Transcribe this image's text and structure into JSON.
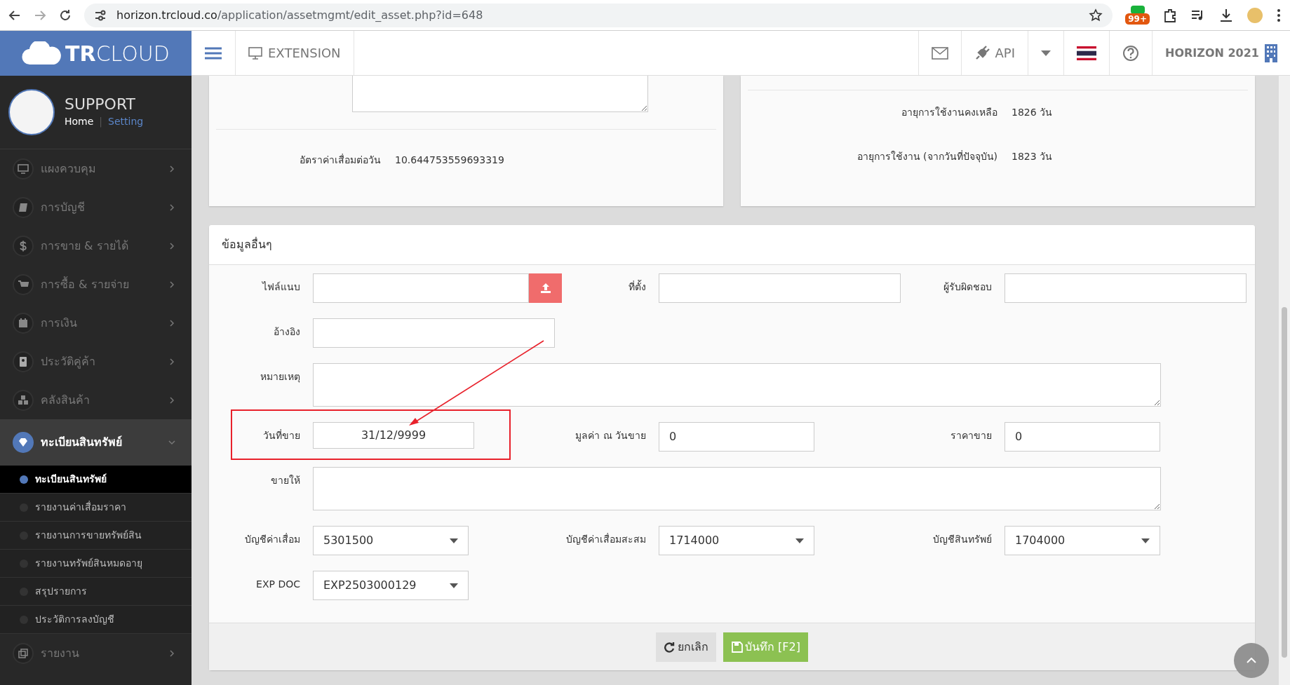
{
  "browser": {
    "url_host": "horizon.trcloud.co",
    "url_path": "/application/assetmgmt/edit_asset.php?id=648",
    "extension_badge": "99+"
  },
  "header": {
    "logo_bold": "TR",
    "logo_light": "CLOUD",
    "extension": "EXTENSION",
    "api": "API",
    "company": "HORIZON 2021"
  },
  "user": {
    "name": "SUPPORT",
    "home": "Home",
    "separator": "|",
    "setting": "Setting"
  },
  "sidebar": {
    "items": [
      {
        "label": "แผงควบคุม",
        "expanded": false,
        "selected": false
      },
      {
        "label": "การบัญชี",
        "expanded": false,
        "selected": false
      },
      {
        "label": "การขาย & รายได้",
        "expanded": false,
        "selected": false
      },
      {
        "label": "การซื้อ & รายจ่าย",
        "expanded": false,
        "selected": false
      },
      {
        "label": "การเงิน",
        "expanded": false,
        "selected": false
      },
      {
        "label": "ประวัติคู่ค้า",
        "expanded": false,
        "selected": false
      },
      {
        "label": "คลังสินค้า",
        "expanded": false,
        "selected": false
      },
      {
        "label": "ทะเบียนสินทรัพย์",
        "expanded": true,
        "selected": true,
        "children": [
          {
            "label": "ทะเบียนสินทรัพย์",
            "selected": true
          },
          {
            "label": "รายงานค่าเสื่อมราคา",
            "selected": false
          },
          {
            "label": "รายงานการขายทรัพย์สิน",
            "selected": false
          },
          {
            "label": "รายงานทรัพย์สินหมดอายุ",
            "selected": false
          },
          {
            "label": "สรุปรายการ",
            "selected": false
          },
          {
            "label": "ประวัติการลงบัญชี",
            "selected": false
          }
        ]
      },
      {
        "label": "รายงาน",
        "expanded": false,
        "selected": false
      }
    ]
  },
  "summary_left": {
    "rows": [
      {
        "label": "อัตราค่าเสื่อมต่อวัน",
        "value": "10.644753559693319"
      }
    ]
  },
  "summary_right": {
    "rows": [
      {
        "label": "อายุการใช้งานคงเหลือ",
        "value": "1826 วัน"
      },
      {
        "label": "อายุการใช้งาน (จากวันที่ปัจจุบัน)",
        "value": "1823 วัน"
      }
    ]
  },
  "panel": {
    "title": "ข้อมูลอื่นๆ",
    "rows": [
      [
        {
          "kind": "file",
          "label": "ไฟล์แนบ"
        },
        {
          "kind": "text",
          "label": "ที่ตั้ง"
        },
        {
          "kind": "text",
          "label": "ผู้รับผิดชอบ"
        }
      ],
      [
        {
          "kind": "text",
          "label": "อ้างอิง"
        }
      ],
      [
        {
          "kind": "textarea",
          "label": "หมายเหตุ"
        }
      ],
      [
        {
          "kind": "date",
          "label": "วันที่ขาย",
          "value": "31/12/9999"
        },
        {
          "kind": "short",
          "label": "มูลค่า ณ วันขาย",
          "value": "0"
        },
        {
          "kind": "short",
          "label": "ราคาขาย",
          "value": "0"
        }
      ],
      [
        {
          "kind": "textarea",
          "label": "ขายให้"
        }
      ],
      [
        {
          "kind": "select",
          "label": "บัญชีค่าเสื่อม",
          "value": "5301500"
        },
        {
          "kind": "select",
          "label": "บัญชีค่าเสื่อมสะสม",
          "value": "1714000"
        },
        {
          "kind": "select",
          "label": "บัญชีสินทรัพย์",
          "value": "1704000"
        }
      ],
      [
        {
          "kind": "select",
          "label": "EXP DOC",
          "value": "EXP2503000129"
        }
      ]
    ],
    "buttons": [
      {
        "kind": "cancel",
        "label": "ยกเลิก"
      },
      {
        "kind": "save",
        "label": "บันทึก [F2]"
      }
    ]
  },
  "annotation": {
    "highlight_box": true,
    "pointer_arrow": true
  }
}
